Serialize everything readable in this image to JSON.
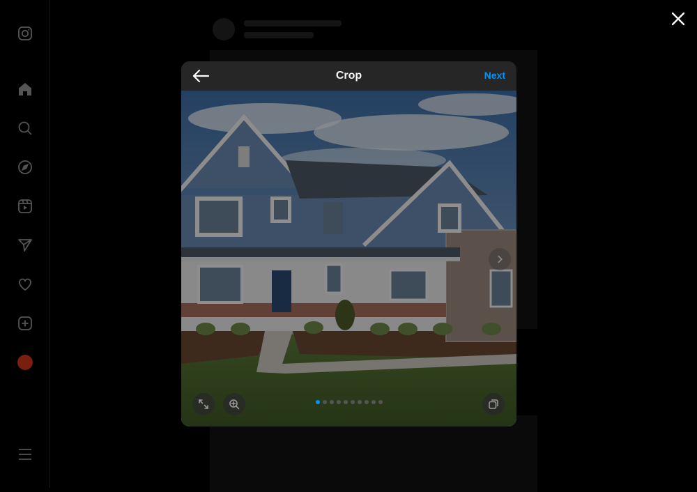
{
  "sidebar": {
    "items": [
      {
        "icon": "instagram-logo-icon"
      },
      {
        "icon": "home-icon"
      },
      {
        "icon": "search-icon"
      },
      {
        "icon": "explore-compass-icon"
      },
      {
        "icon": "reels-icon"
      },
      {
        "icon": "messages-send-icon"
      },
      {
        "icon": "notifications-heart-icon"
      },
      {
        "icon": "create-plus-icon"
      },
      {
        "icon": "profile-avatar"
      },
      {
        "icon": "more-menu-icon"
      }
    ]
  },
  "modal": {
    "title": "Crop",
    "next_label": "Next",
    "accent_color": "#0095f6",
    "photo_count": 10,
    "current_photo": 1
  },
  "controls": {
    "aspect_ratio_icon": "expand-icon",
    "zoom_icon": "zoom-in-icon",
    "gallery_icon": "multiple-photos-icon",
    "next_photo_icon": "chevron-right-icon",
    "close_icon": "close-icon",
    "back_icon": "arrow-left-icon"
  }
}
